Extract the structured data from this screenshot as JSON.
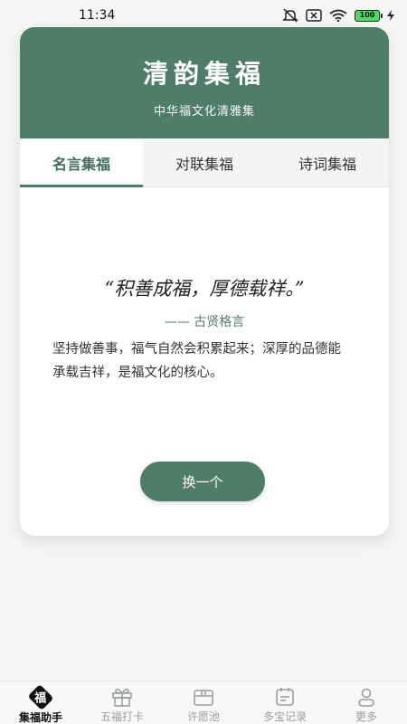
{
  "status": {
    "time": "11:34",
    "battery": "100"
  },
  "header": {
    "title": "清韵集福",
    "subtitle": "中华福文化清雅集"
  },
  "tabs": [
    {
      "label": "名言集福",
      "active": true
    },
    {
      "label": "对联集福",
      "active": false
    },
    {
      "label": "诗词集福",
      "active": false
    }
  ],
  "content": {
    "quote": "“积善成福，厚德载祥。”",
    "source": "—— 古贤格言",
    "explanation": "坚持做善事，福气自然会积累起来；深厚的品德能承载吉祥，是福文化的核心。",
    "button_label": "换一个"
  },
  "nav": {
    "items": [
      {
        "label": "集福助手",
        "icon": "fu-icon",
        "active": true
      },
      {
        "label": "五福打卡",
        "icon": "gift-icon",
        "active": false
      },
      {
        "label": "许愿池",
        "icon": "box-icon",
        "active": false
      },
      {
        "label": "多宝记录",
        "icon": "record-icon",
        "active": false
      },
      {
        "label": "更多",
        "icon": "user-icon",
        "active": false
      }
    ],
    "badge_char": "福"
  },
  "colors": {
    "primary": "#4e7d6a",
    "background": "#f4f6f4",
    "inactive": "#9aa09c"
  }
}
